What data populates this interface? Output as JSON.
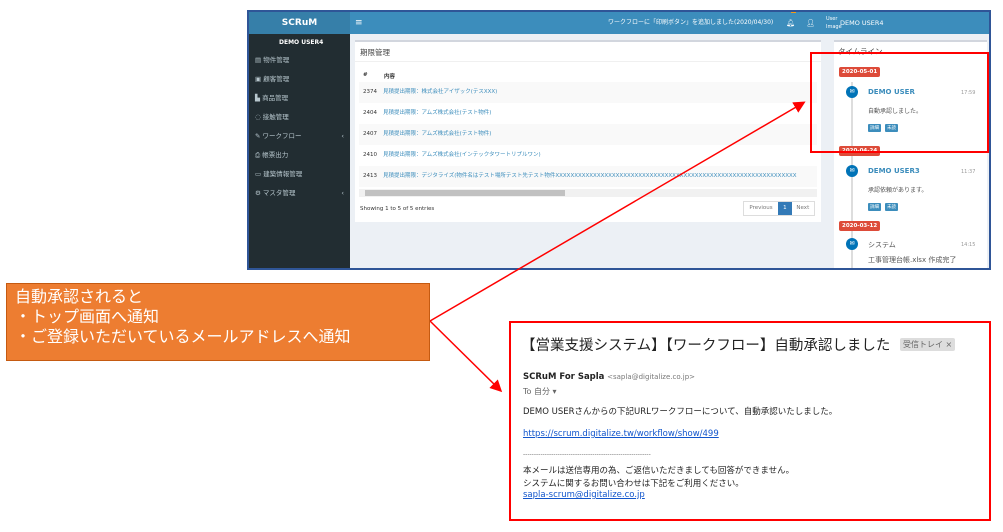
{
  "app": {
    "brand": "SCRuM",
    "menu_icon": "hamburger-icon",
    "announcement": "ワークフローに「印刷ボタン」を追加しました(2020/04/30)",
    "notification_count": "2",
    "user_image_alt": "User Image",
    "user_name": "DEMO USER4"
  },
  "sidebar": {
    "user": "DEMO USER4",
    "items": [
      {
        "label": "物件管理",
        "icon": "building-icon"
      },
      {
        "label": "顧客管理",
        "icon": "id-card-icon"
      },
      {
        "label": "商品管理",
        "icon": "product-icon"
      },
      {
        "label": "接触管理",
        "icon": "chat-icon"
      },
      {
        "label": "ワークフロー",
        "icon": "edit-icon",
        "chevron": "‹"
      },
      {
        "label": "帳票出力",
        "icon": "print-icon"
      },
      {
        "label": "建築情報管理",
        "icon": "keyboard-icon"
      },
      {
        "label": "マスタ管理",
        "icon": "cogs-icon",
        "chevron": "‹"
      }
    ]
  },
  "main": {
    "title": "期限管理",
    "columns": [
      "#",
      "内容"
    ],
    "rows": [
      {
        "id": "2374",
        "content": "見積提出期限：株式会社アイザック(テスXXX)"
      },
      {
        "id": "2404",
        "content": "見積提出期限：アムズ株式会社(テスト物件)"
      },
      {
        "id": "2407",
        "content": "見積提出期限：アムズ株式会社(テスト物件)"
      },
      {
        "id": "2410",
        "content": "見積提出期限：アムズ株式会社(インテックタワートリプルワン)"
      },
      {
        "id": "2413",
        "content": "見積提出期限：デジタライズ(物件名はテスト場所テスト先テスト物件XXXXXXXXXXXXXXXXXXXXXXXXXXXXXXXXXXXXXXXXXXXXXXXXXXXXXXXXXXXXXXXX"
      }
    ],
    "info": "Showing 1 to 5 of 5 entries",
    "prev": "Previous",
    "page": "1",
    "next": "Next"
  },
  "timeline": {
    "title": "タイムライン",
    "items": [
      {
        "date": "2020-05-01",
        "name": "DEMO USER",
        "time": "17:59",
        "text": "自動承認しました。",
        "tags": [
          "詳細",
          "未読"
        ]
      },
      {
        "date": "2020-04-24",
        "name": "DEMO USER3",
        "time": "11:37",
        "text": "承認依頼があります。",
        "tags": [
          "詳細",
          "未読"
        ]
      },
      {
        "date": "2020-03-12",
        "name": "システム",
        "time": "14:15",
        "text": "工事管理台帳.xlsx 作成完了"
      }
    ]
  },
  "note": {
    "lines": [
      "自動承認されると",
      "・トップ画面へ通知",
      "・ご登録いただいているメールアドレスへ通知"
    ]
  },
  "mail": {
    "subject": "【営業支援システム】【ワークフロー】自動承認しました",
    "label": "受信トレイ",
    "label_close": "×",
    "sender": "SCRuM For Sapla",
    "sender_email": "<sapla@digitalize.co.jp>",
    "to": "To 自分",
    "body1": "DEMO USERさんからの下記URLワークフローについて、自動承認いたしました。",
    "link": "https://scrum.digitalize.tw/workflow/show/499",
    "divider": "-----------------------------------------------------------",
    "footer1": "本メールは送信専用の為、ご返信いただきましても回答ができません。",
    "footer2": "システムに関するお問い合わせは下記をご利用ください。",
    "contact": "sapla-scrum@digitalize.co.jp"
  },
  "colors": {
    "accent": "#3c8dbc",
    "sidebar": "#222d32",
    "badge": "#dd4b39",
    "note": "#ed7d31",
    "highlight": "#ff0000"
  }
}
